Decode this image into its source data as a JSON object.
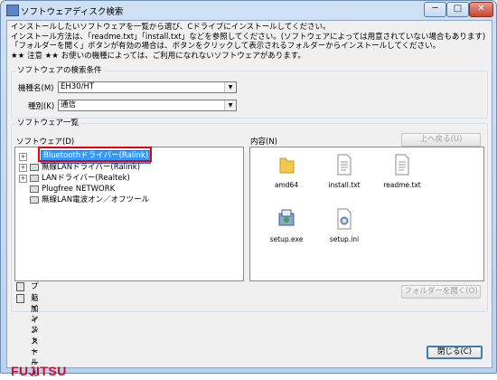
{
  "window": {
    "title": "ソフトウェアディスク検索",
    "controls": {
      "minimize": "─",
      "maximize": "□",
      "close": "✕"
    }
  },
  "intro": [
    "インストールしたいソフトウェアを一覧から選び、Cドライブにインストールしてください。",
    "インストール方法は、「readme.txt」「install.txt」などを参照してください。(ソフトウェアによっては用意されていない場合もあります)",
    "「フォルダーを開く」ボタンが有効の場合は、ボタンをクリックして表示されるフォルダーからインストールしてください。",
    "★★ 注意 ★★ お使いの機種によっては、ご利用になれないソフトウェアがあります。"
  ],
  "search": {
    "legend": "ソフトウェアの検索条件",
    "model_label": "機種名(M)",
    "model_value": "EH30/HT",
    "type_label": "種別(K)",
    "type_value": "通信"
  },
  "software_list": {
    "legend": "ソフトウェア一覧",
    "tree_label": "ソフトウェア(D)",
    "items": [
      {
        "label": "Bluetoothドライバー(Ralink)",
        "expander": "+",
        "selected": true
      },
      {
        "label": "無線LANドライバー(Ralink)",
        "expander": "+",
        "selected": false
      },
      {
        "label": "LANドライバー(Realtek)",
        "expander": "+",
        "selected": false
      },
      {
        "label": "Plugfree NETWORK",
        "expander": "",
        "selected": false
      },
      {
        "label": "無線LAN電波オン／オフツール",
        "expander": "",
        "selected": false
      }
    ],
    "content_label": "内容(N)",
    "up_button": "上へ戻る(U)",
    "files": [
      {
        "name": "amd64",
        "icon": "folder-icon"
      },
      {
        "name": "install.txt",
        "icon": "text-file-icon"
      },
      {
        "name": "readme.txt",
        "icon": "text-file-icon"
      },
      {
        "name": "setup.exe",
        "icon": "installer-icon"
      },
      {
        "name": "setup.ini",
        "icon": "settings-file-icon"
      }
    ],
    "actions": [
      {
        "label": "プレインストール"
      },
      {
        "label": "追加インストール"
      }
    ],
    "open_folder_button": "フォルダーを開く(O)"
  },
  "footer": {
    "logo_text": "FUJITSU",
    "close_button": "閉じる(C)"
  },
  "colors": {
    "highlight_frame": "#e60012",
    "selection": "#3399ff",
    "logo": "#c8102e"
  }
}
